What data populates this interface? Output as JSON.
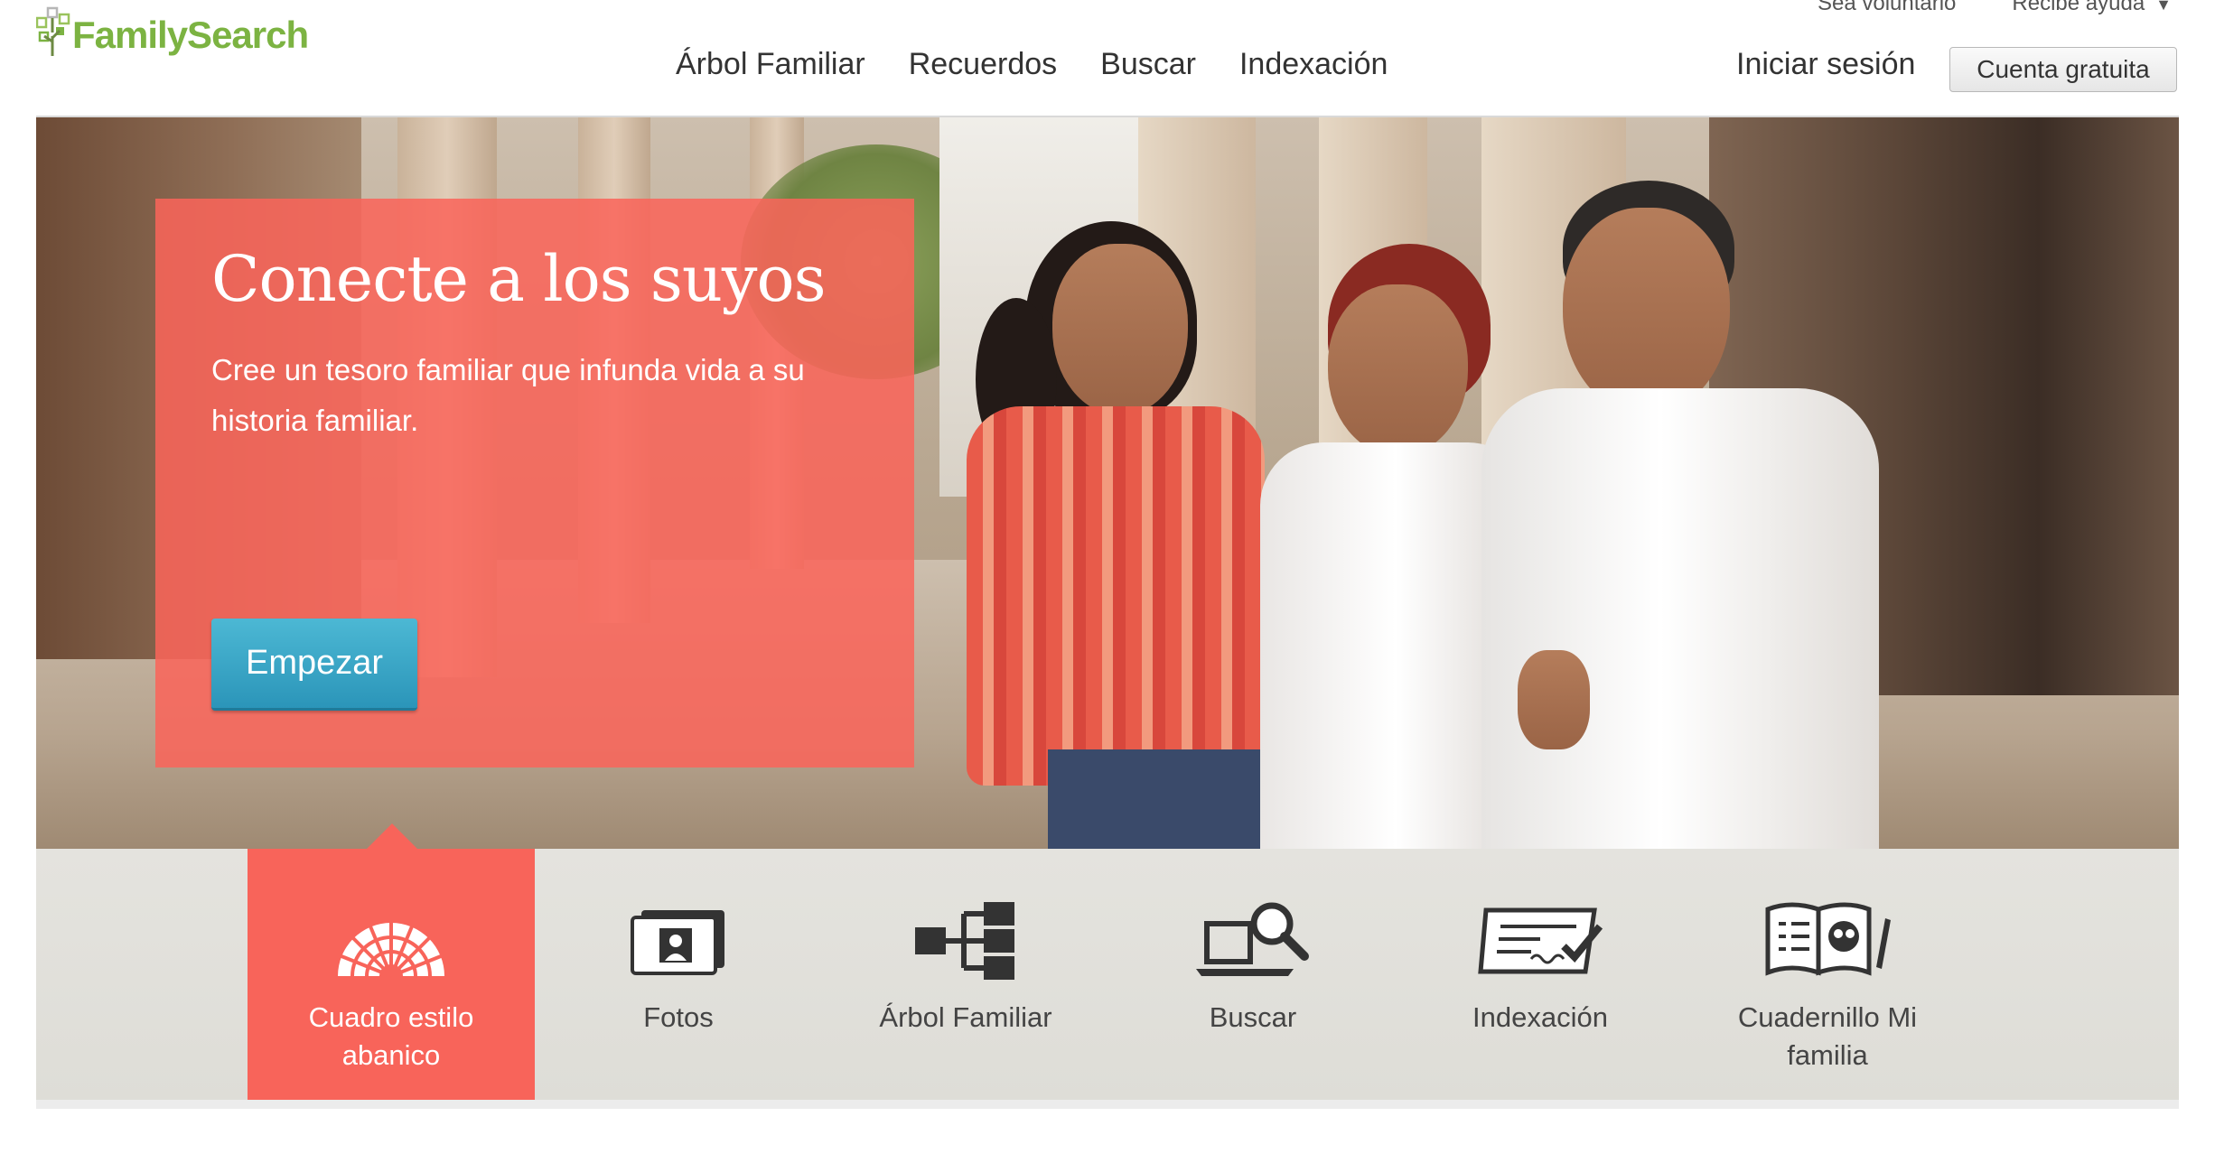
{
  "utility": {
    "volunteer": "Sea voluntario",
    "help": "Recibe ayuda",
    "help_caret": "▼"
  },
  "brand": {
    "name": "FamilySearch",
    "color": "#7cb342"
  },
  "nav": {
    "items": [
      {
        "label": "Árbol Familiar"
      },
      {
        "label": "Recuerdos"
      },
      {
        "label": "Buscar"
      },
      {
        "label": "Indexación"
      }
    ],
    "signin": "Iniciar sesión",
    "free_account": "Cuenta gratuita"
  },
  "hero": {
    "title": "Conecte a los suyos",
    "subtitle": "Cree un tesoro familiar que infunda vida a su historia familiar.",
    "cta": "Empezar",
    "panel_color": "#fa645a",
    "cta_color": "#3aa7c9"
  },
  "features": {
    "items": [
      {
        "label": "Cuadro estilo abanico",
        "icon": "fan-chart-icon",
        "active": true
      },
      {
        "label": "Fotos",
        "icon": "photos-icon",
        "active": false
      },
      {
        "label": "Árbol Familiar",
        "icon": "family-tree-icon",
        "active": false
      },
      {
        "label": "Buscar",
        "icon": "search-laptop-icon",
        "active": false
      },
      {
        "label": "Indexación",
        "icon": "indexing-icon",
        "active": false
      },
      {
        "label": "Cuadernillo Mi familia",
        "icon": "booklet-icon",
        "active": false
      }
    ]
  }
}
